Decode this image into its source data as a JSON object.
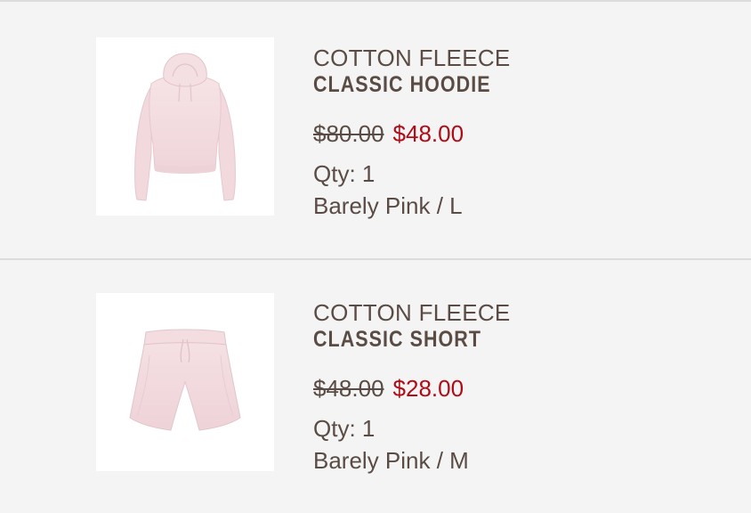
{
  "cart": {
    "items": [
      {
        "image": "pink-hoodie-photo",
        "collection": "COTTON FLEECE",
        "name": "CLASSIC HOODIE",
        "original_price": "$80.00",
        "sale_price": "$48.00",
        "quantity": "Qty: 1",
        "variant": "Barely Pink / L"
      },
      {
        "image": "pink-shorts-photo",
        "collection": "COTTON FLEECE",
        "name": "CLASSIC SHORT",
        "original_price": "$48.00",
        "sale_price": "$28.00",
        "quantity": "Qty: 1",
        "variant": "Barely Pink / M"
      }
    ]
  },
  "colors": {
    "background": "#f4f4f4",
    "text": "#5a4c45",
    "sale_price": "#b00c17",
    "divider": "#dcdcdc",
    "product_tint": "#f3dde1"
  }
}
